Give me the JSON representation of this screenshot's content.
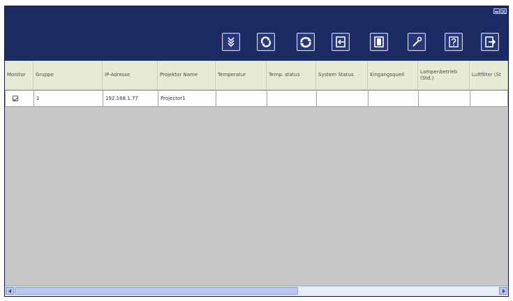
{
  "toolbar": {
    "buttons": [
      {
        "icon": "collapse-icon"
      },
      {
        "icon": "refresh-icon"
      },
      {
        "icon": "sync-icon"
      },
      {
        "icon": "import-icon"
      },
      {
        "icon": "save-icon"
      },
      {
        "icon": "settings-icon"
      },
      {
        "icon": "help-icon"
      },
      {
        "icon": "exit-icon"
      }
    ]
  },
  "table": {
    "columns": [
      "Monitor",
      "Gruppe",
      "IP-Adresse",
      "Projektor Name",
      "Temperatur",
      "Temp. status",
      "System Status",
      "Eingangsquell",
      "Lampenbetrieb (Std.)",
      "Luftfilter (St"
    ],
    "rows": [
      {
        "monitor_checked": true,
        "gruppe": "1",
        "ip": "192.168.1.77",
        "name": "Projector1",
        "temperatur": "",
        "temp_status": "",
        "system_status": "",
        "eingangsquell": "",
        "lampenbetrieb": "",
        "luftfilter": ""
      }
    ]
  },
  "colors": {
    "window_background": "#1c2b63",
    "header_background": "#e6ebd3",
    "content_background": "#c6c6c6"
  }
}
